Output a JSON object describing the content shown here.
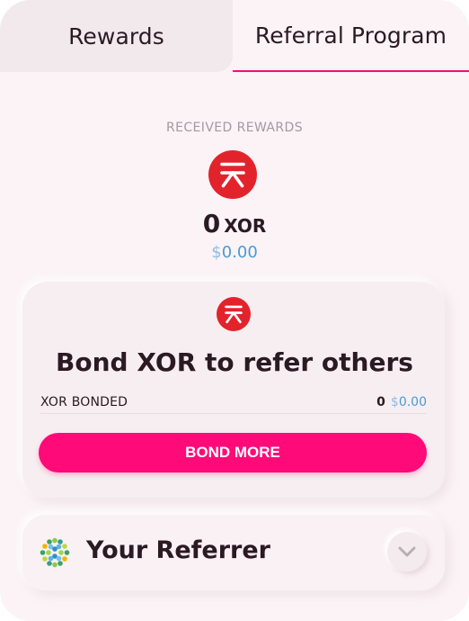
{
  "tabs": [
    {
      "label": "Rewards",
      "active": false
    },
    {
      "label": "Referral Program",
      "active": true
    }
  ],
  "received": {
    "title": "RECEIVED REWARDS",
    "amount": "0",
    "token": "XOR",
    "fiat_symbol": "$",
    "fiat_value": "0.00"
  },
  "bond": {
    "title": "Bond XOR to refer others",
    "row_label": "XOR BONDED",
    "row_amount": "0",
    "row_fiat_symbol": "$",
    "row_fiat_value": "0.00",
    "button_label": "BOND MORE"
  },
  "referrer": {
    "title": "Your Referrer",
    "expand_icon": "chevron-down-icon"
  },
  "colors": {
    "accent": "#ff0a79",
    "xor_red": "#e3232c",
    "fiat_blue": "#4a9bd8",
    "background": "#fbf3f6"
  }
}
